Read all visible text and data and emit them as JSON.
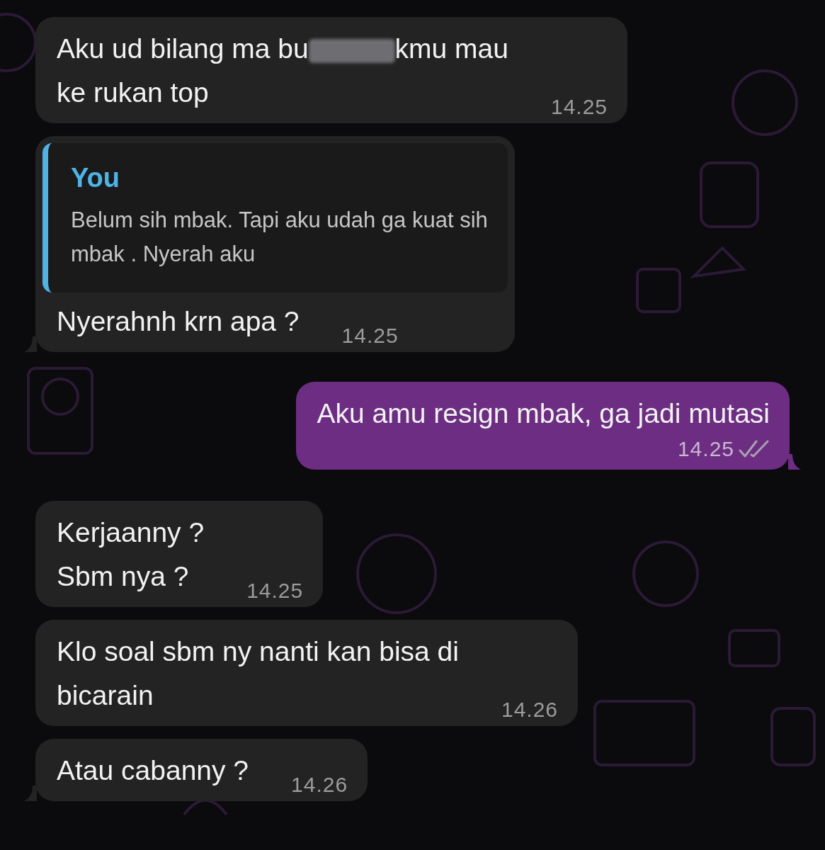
{
  "messages": [
    {
      "kind": "incoming",
      "tail": false,
      "parts": [
        {
          "kind": "text",
          "text": "Aku ud bilang ma bu"
        },
        {
          "kind": "redacted"
        },
        {
          "kind": "text",
          "text": "kmu mau"
        },
        {
          "kind": "break"
        },
        {
          "kind": "text",
          "text": "ke rukan top"
        }
      ],
      "time": "14.25"
    },
    {
      "kind": "incoming",
      "tail": true,
      "quote": {
        "author": "You",
        "text": "Belum sih mbak. Tapi aku udah ga kuat sih\nmbak . Nyerah aku"
      },
      "parts": [
        {
          "kind": "text",
          "text": "Nyerahnh krn apa ?"
        }
      ],
      "time": "14.25"
    },
    {
      "kind": "outgoing",
      "tail": true,
      "parts": [
        {
          "kind": "text",
          "text": "Aku amu resign mbak, ga jadi mutasi"
        }
      ],
      "time": "14.25",
      "delivered": true
    },
    {
      "kind": "incoming",
      "tail": false,
      "parts": [
        {
          "kind": "text",
          "text": "Kerjaanny ?\nSbm nya ?"
        }
      ],
      "time": "14.25"
    },
    {
      "kind": "incoming",
      "tail": false,
      "parts": [
        {
          "kind": "text",
          "text": "Klo soal sbm ny nanti kan bisa di\nbicarain"
        }
      ],
      "time": "14.26"
    },
    {
      "kind": "incoming",
      "tail": true,
      "parts": [
        {
          "kind": "text",
          "text": "Atau cabanny ?"
        }
      ],
      "time": "14.26"
    }
  ]
}
